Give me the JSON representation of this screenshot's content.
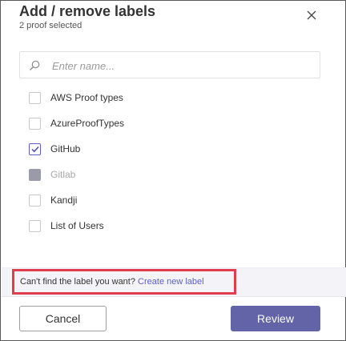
{
  "dialog": {
    "title": "Add / remove labels",
    "subtitle": "2 proof selected"
  },
  "search": {
    "placeholder": "Enter name...",
    "value": ""
  },
  "labels": [
    {
      "label": "AWS Proof types",
      "state": "unchecked"
    },
    {
      "label": "AzureProofTypes",
      "state": "unchecked"
    },
    {
      "label": "GitHub",
      "state": "checked"
    },
    {
      "label": "Gitlab",
      "state": "disabled"
    },
    {
      "label": "Kandji",
      "state": "unchecked"
    },
    {
      "label": "List of Users",
      "state": "unchecked"
    }
  ],
  "footer": {
    "prompt": "Can't find the label you want?",
    "link": "Create new label"
  },
  "actions": {
    "cancel": "Cancel",
    "review": "Review"
  },
  "colors": {
    "accent": "#6264a7",
    "link": "#5b5fc7",
    "highlight": "#e03e4f"
  }
}
